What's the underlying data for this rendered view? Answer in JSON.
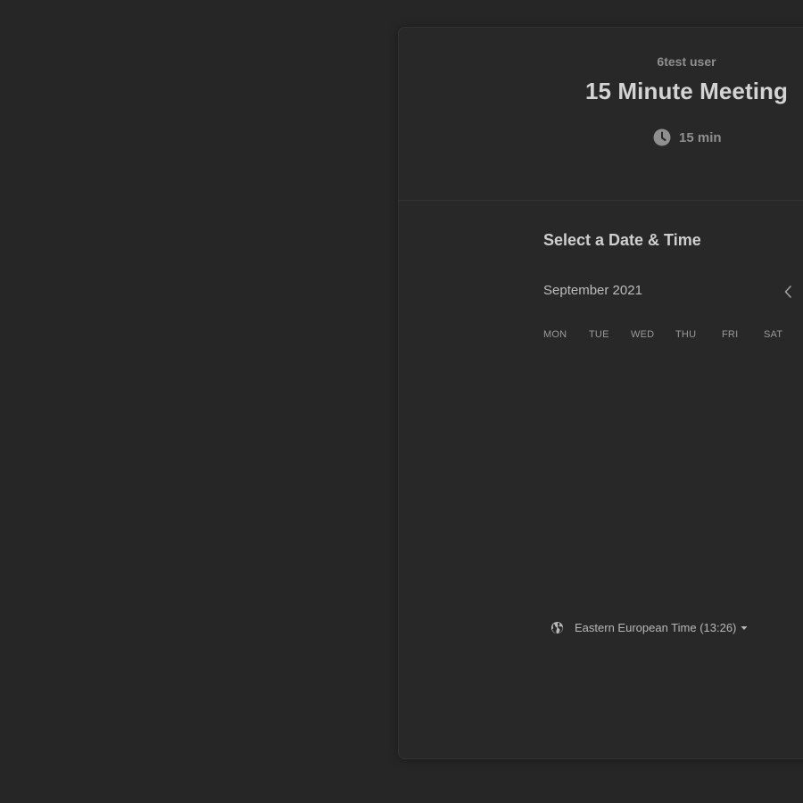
{
  "event": {
    "host_name": "6test user",
    "title": "15 Minute Meeting",
    "duration": "15 min"
  },
  "calendar": {
    "section_title": "Select a Date & Time",
    "month_label": "September 2021",
    "weekdays": [
      "MON",
      "TUE",
      "WED",
      "THU",
      "FRI",
      "SAT"
    ]
  },
  "timezone": {
    "label": "Eastern European Time (13:26)"
  },
  "colors": {
    "background": "#262626",
    "card": "#282828",
    "title_text": "#d4d4d4",
    "muted_text": "#8f8f8f"
  },
  "icons": {
    "duration": "clock-icon",
    "prev_month": "chevron-left-icon",
    "timezone": "globe-icon",
    "timezone_dropdown": "caret-down-icon"
  }
}
